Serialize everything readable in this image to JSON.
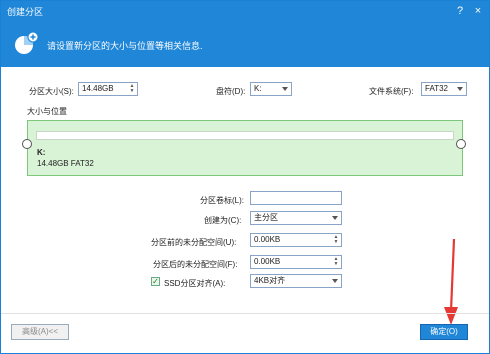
{
  "window": {
    "title": "创建分区",
    "help_glyph": "?",
    "close_glyph": "×"
  },
  "banner": {
    "text": "请设置新分区的大小与位置等相关信息.",
    "icon": "add-partition-icon"
  },
  "top_row": {
    "size_label": "分区大小(S):",
    "size_value": "14.48GB",
    "drive_label": "盘符(D):",
    "drive_value": "K:",
    "fs_label": "文件系统(F):",
    "fs_value": "FAT32"
  },
  "size_position": {
    "title": "大小与位置",
    "partition_letter": "K:",
    "partition_info": "14.48GB FAT32"
  },
  "form": {
    "volume_label_label": "分区卷标(L):",
    "volume_label_value": "",
    "create_as_label": "创建为(C):",
    "create_as_value": "主分区",
    "unalloc_before_label": "分区前的未分配空间(U):",
    "unalloc_before_value": "0.00KB",
    "unalloc_after_label": "分区后的未分配空间(F):",
    "unalloc_after_value": "0.00KB",
    "ssd_align_label": "SSD分区对齐(A):",
    "ssd_align_checked": true,
    "ssd_align_value": "4KB对齐"
  },
  "footer": {
    "advanced_label": "高级(A)<<",
    "ok_label": "确定(O)"
  },
  "colors": {
    "accent": "#1f86d8",
    "green_panel": "#d9f3d6",
    "arrow": "#e53935"
  }
}
